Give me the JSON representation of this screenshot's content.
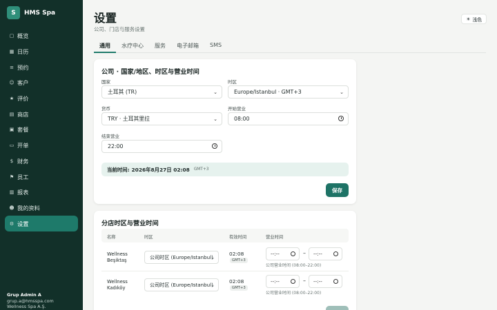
{
  "brand": {
    "logo_letter": "S",
    "name": "HMS Spa"
  },
  "nav": [
    {
      "icon": "▢",
      "label": "概览"
    },
    {
      "icon": "▦",
      "label": "日历"
    },
    {
      "icon": "≡",
      "label": "预约"
    },
    {
      "icon": "☺",
      "label": "客户"
    },
    {
      "icon": "★",
      "label": "评价"
    },
    {
      "icon": "▤",
      "label": "商店"
    },
    {
      "icon": "▣",
      "label": "套餐"
    },
    {
      "icon": "▭",
      "label": "开单"
    },
    {
      "icon": "$",
      "label": "财务"
    },
    {
      "icon": "⚑",
      "label": "员工"
    },
    {
      "icon": "▥",
      "label": "报表"
    },
    {
      "icon": "☻",
      "label": "我的资料"
    },
    {
      "icon": "⚙",
      "label": "设置"
    }
  ],
  "user": {
    "name": "Grup Admin A",
    "email": "grup.a@hmsspa.com",
    "company": "Wellness Spa A.Ş."
  },
  "page": {
    "title": "设置",
    "subtitle": "公司、门店与服务设置",
    "theme_label": "浅色",
    "theme_icon": "☀"
  },
  "tabs": [
    "通用",
    "水疗中心",
    "服务",
    "电子邮箱",
    "SMS"
  ],
  "company_card": {
    "title": "公司 · 国家/地区、时区与营业时间",
    "country_label": "国家",
    "country_value": "土耳其 (TR)",
    "timezone_label": "时区",
    "timezone_value": "Europe/Istanbul · GMT+3",
    "currency_label": "货币",
    "currency_value": "TRY · 土耳其里拉",
    "open_label": "开始营业",
    "open_value": "08:00",
    "close_label": "结束营业",
    "close_value": "22:00",
    "current_time_label": "当前时间:",
    "current_time_value": "2026年8月27日 02:08",
    "current_time_tz": "GMT+3",
    "save_label": "保存"
  },
  "branch_card": {
    "title": "分店时区与营业时间",
    "headers": {
      "name": "名称",
      "timezone": "时区",
      "effective": "有效时间",
      "hours": "营业时间"
    },
    "rows": [
      {
        "name": "Wellness Beşiktaş",
        "timezone": "公司时区 (Europe/Istanbul)",
        "time": "02:08",
        "tz": "GMT+3",
        "open": "--:--",
        "close": "--:--",
        "dash": "–",
        "note": "公司营业时间 (08:00–22:00)"
      },
      {
        "name": "Wellness Kadıköy",
        "timezone": "公司时区 (Europe/Istanbul)",
        "time": "02:08",
        "tz": "GMT+3",
        "open": "--:--",
        "close": "--:--",
        "dash": "–",
        "note": "公司营业时间 (08:00–22:00)"
      }
    ]
  }
}
